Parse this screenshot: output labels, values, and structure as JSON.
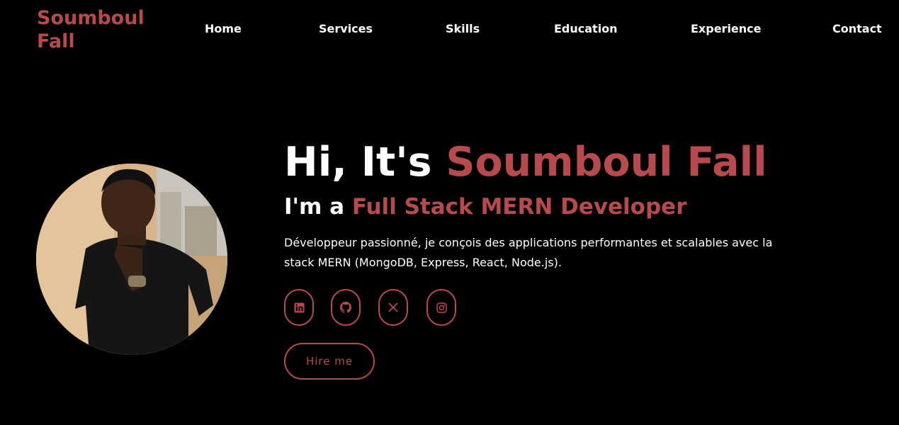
{
  "header": {
    "logo": "Soumboul Fall",
    "nav": [
      "Home",
      "Services",
      "Skills",
      "Education",
      "Experience",
      "Contact"
    ]
  },
  "hero": {
    "greeting": "Hi, It's ",
    "name": "Soumboul Fall",
    "role_prefix": "I'm a ",
    "role": "Full Stack MERN Developer",
    "description": "Développeur passionné, je conçois des applications performantes et scalables avec la stack MERN (MongoDB, Express, React, Node.js).",
    "hire_label": "Hire me",
    "social": [
      "linkedin-icon",
      "github-icon",
      "x-twitter-icon",
      "instagram-icon"
    ]
  },
  "colors": {
    "accent": "#b84a4d",
    "background": "#000000",
    "text": "#ffffff"
  }
}
